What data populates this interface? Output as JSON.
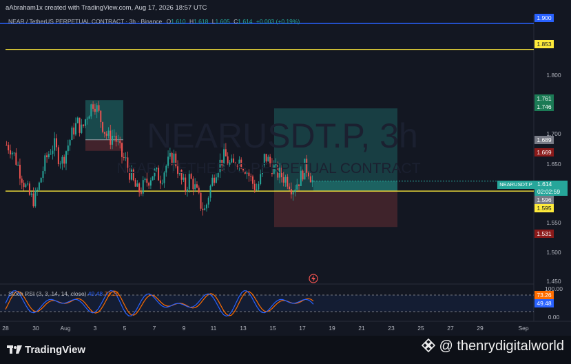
{
  "header": {
    "credit": "aAbraham1x created with TradingView.com, Aug 17, 2026 18:57 UTC"
  },
  "legend": {
    "symbol_line": "NEAR / TetherUS PERPETUAL CONTRACT · 3h · Binance",
    "o_label": "O",
    "o": "1.610",
    "h_label": "H",
    "h": "1.618",
    "l_label": "L",
    "l": "1.605",
    "c_label": "C",
    "c": "1.614",
    "change": "+0.003 (+0.19%)"
  },
  "watermark": {
    "symbol": "NEARUSDT.P, 3h",
    "description": "NEAR / TETHERUS PERPETUAL CONTRACT"
  },
  "price_axis": {
    "ticks": [
      "1.800",
      "1.700",
      "1.650",
      "1.550",
      "1.500",
      "1.450"
    ]
  },
  "price_tags": {
    "t1900": "1.900",
    "t1853": "1.853",
    "t1761": "1.761",
    "t1746": "1.746",
    "t1689": "1.689",
    "t1669": "1.669",
    "symbol": "NEARUSDT.P",
    "last": "1.614",
    "countdown": "02:02:59",
    "t1596": "1.596",
    "t1595": "1.595",
    "t1531": "1.531"
  },
  "stoch": {
    "label": "Stoch RSI",
    "params": "3, 3, 14, 14, close",
    "k_value": "49.48",
    "d_value": "73.26",
    "axis": [
      "100.00",
      "0.00"
    ],
    "tag_d": "73.26",
    "tag_k": "49.48"
  },
  "time_axis": [
    "28",
    "30",
    "Aug",
    "3",
    "5",
    "7",
    "9",
    "11",
    "13",
    "15",
    "17",
    "19",
    "21",
    "23",
    "25",
    "27",
    "29",
    "Sep"
  ],
  "footer": {
    "logo_text": "TradingView",
    "handle": "@ thenrydigitalworld"
  },
  "colors": {
    "background": "#131722",
    "up": "#26a69a",
    "down": "#ef5350",
    "hline_yellow": "#ffeb3b",
    "hline_blue": "#2962ff",
    "stoch_k": "#2962ff",
    "stoch_d": "#ff6d00"
  },
  "chart_data": {
    "type": "candlestick",
    "symbol": "NEARUSDT.P",
    "timeframe": "3h",
    "ylim": [
      1.43,
      1.915
    ],
    "horizontal_lines": [
      1.9,
      1.853,
      1.596
    ],
    "long_position": {
      "entry": 1.596,
      "target": 1.746,
      "stop": 1.531
    },
    "zone_boxes": [
      {
        "top": 1.761,
        "bottom": 1.689,
        "kind": "green"
      },
      {
        "top": 1.689,
        "bottom": 1.669,
        "kind": "red"
      }
    ],
    "close_path": [
      1.68,
      1.675,
      1.66,
      1.64,
      1.62,
      1.6,
      1.585,
      1.58,
      1.6,
      1.63,
      1.655,
      1.67,
      1.68,
      1.66,
      1.65,
      1.67,
      1.69,
      1.71,
      1.72,
      1.705,
      1.73,
      1.745,
      1.76,
      1.74,
      1.72,
      1.7,
      1.69,
      1.7,
      1.68,
      1.66,
      1.65,
      1.63,
      1.61,
      1.595,
      1.6,
      1.61,
      1.62,
      1.63,
      1.625,
      1.62,
      1.64,
      1.65,
      1.66,
      1.64,
      1.615,
      1.6,
      1.62,
      1.61,
      1.59,
      1.57,
      1.56,
      1.595,
      1.62,
      1.64,
      1.65,
      1.66,
      1.645,
      1.64,
      1.655,
      1.65,
      1.64,
      1.625,
      1.61,
      1.6,
      1.62,
      1.66,
      1.65,
      1.64,
      1.63,
      1.625,
      1.62,
      1.615,
      1.6,
      1.61,
      1.62,
      1.64,
      1.635,
      1.614
    ]
  }
}
